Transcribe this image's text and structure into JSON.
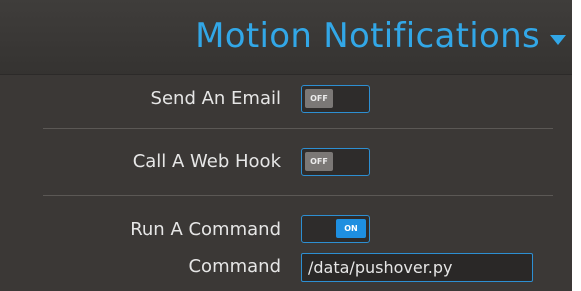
{
  "header": {
    "title": "Motion Notifications"
  },
  "settings": {
    "send_email": {
      "label": "Send An Email",
      "toggle_text": "OFF",
      "state": "off"
    },
    "web_hook": {
      "label": "Call A Web Hook",
      "toggle_text": "OFF",
      "state": "off"
    },
    "run_command": {
      "label": "Run A Command",
      "toggle_text": "ON",
      "state": "on"
    },
    "command": {
      "label": "Command",
      "value": "/data/pushover.py"
    }
  },
  "colors": {
    "accent": "#32a7e7",
    "toggle_on": "#1e8fe0",
    "panel_bg": "#3b3836"
  },
  "icons": {
    "header_caret": "caret-down-icon"
  }
}
